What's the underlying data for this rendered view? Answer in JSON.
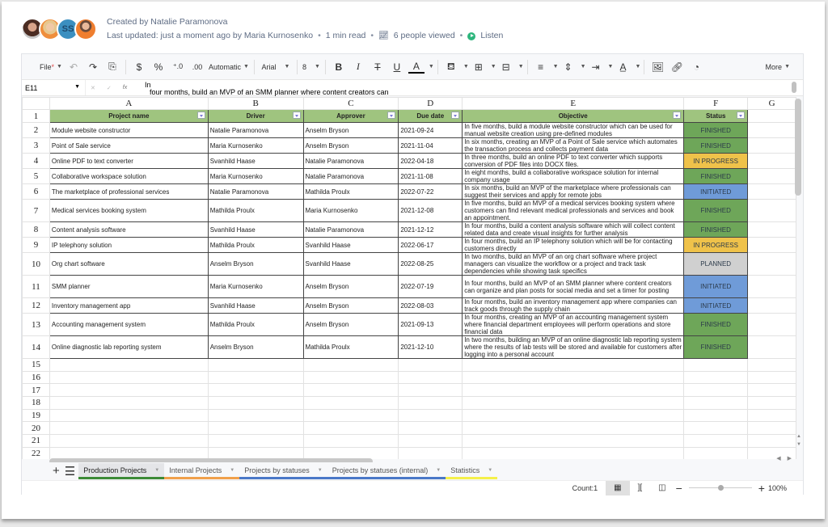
{
  "meta": {
    "created_by": "Created by Natalie Paramonova",
    "last_updated": "Last updated: just a moment ago by Maria Kurnosenko",
    "read_time": "1 min read",
    "viewed": "6 people viewed",
    "listen": "Listen",
    "avatar_initials": "SS"
  },
  "toolbar": {
    "file": "File",
    "file_marker": "*",
    "format": "Automatic",
    "font": "Arial",
    "font_size": "8",
    "more": "More",
    "currency": "$",
    "percent": "%",
    "dec_inc": ".0 .00",
    "dec_dec": ".00 .0"
  },
  "formula_bar": {
    "cell_ref": "E11",
    "value_line1": "In",
    "value_line2": "four months, build an MVP of an SMM planner where content creators can"
  },
  "columns": [
    "A",
    "B",
    "C",
    "D",
    "E",
    "F",
    "G"
  ],
  "headers": [
    "Project   name",
    "Driver",
    "Approver",
    "Due date",
    "Objective",
    "Status"
  ],
  "rows": [
    {
      "num": "2",
      "name": "Module website constructor",
      "driver": "Natalie Paramonova",
      "approver": "Anselm Bryson",
      "due": "2021-09-24",
      "objective": "In   five months, build a module website constructor which can be used for manual   website creation using pre-defined modules",
      "status": "FINISHED"
    },
    {
      "num": "3",
      "name": "Point of Sale service",
      "driver": "Maria Kurnosenko",
      "approver": "Anselm Bryson",
      "due": "2021-11-04",
      "objective": "In   six months, creating an MVP of a Point of Sale service which automates the   transaction process and collects payment data",
      "status": "FINISHED"
    },
    {
      "num": "4",
      "name": "Online PDF to text converter",
      "driver": "Svanhild Haase",
      "approver": "Natalie Paramonova",
      "due": "2022-04-18",
      "objective": "In   three months, build an online PDF to text converter which supports conversion   of PDF files into DOCX files.",
      "status": "IN PROGRESS"
    },
    {
      "num": "5",
      "name": "Collaborative workspace solution",
      "driver": "Maria Kurnosenko",
      "approver": "Natalie Paramonova",
      "due": "2021-11-08",
      "objective": "In   eight months, build a collaborative workspace solution for internal company   usage",
      "status": "FINISHED"
    },
    {
      "num": "6",
      "name": "The marketplace of professional services",
      "driver": "Natalie Paramonova",
      "approver": "Mathilda Proulx",
      "due": "2022-07-22",
      "objective": "In   six months, build an MVP of the marketplace where professionals can  suggest   their services and apply for remote jobs",
      "status": "INITIATED"
    },
    {
      "num": "7",
      "name": "Medical services booking system",
      "driver": "Mathilda Proulx",
      "approver": "Maria Kurnosenko",
      "due": "2021-12-08",
      "objective": "In   five months, build an MVP of a medical services booking system where   customers can find relevant medical professionals and services and book an   appointment.",
      "status": "FINISHED"
    },
    {
      "num": "8",
      "name": "Content analysis software",
      "driver": "Svanhild Haase",
      "approver": "Natalie Paramonova",
      "due": "2021-12-12",
      "objective": "In   four months, build a content analysis software which will collect content   related data and create visual insights for further analysis",
      "status": "FINISHED"
    },
    {
      "num": "9",
      "name": "IP telephony solution",
      "driver": "Mathilda Proulx",
      "approver": "Svanhild Haase",
      "due": "2022-06-17",
      "objective": "In   four months, build an IP telephony solution which will be for contacting   customers directly",
      "status": "IN PROGRESS"
    },
    {
      "num": "10",
      "name": "Org chart software",
      "driver": "Anselm Bryson",
      "approver": "Svanhild Haase",
      "due": "2022-08-25",
      "objective": "In   two months, build an MVP of an org chart software where project managers can   visualize the workflow or a project and track task dependencies while showing   task specifics",
      "status": "PLANNED"
    },
    {
      "num": "11",
      "name": "SMM planner",
      "driver": "Maria Kurnosenko",
      "approver": "Anselm Bryson",
      "due": "2022-07-19",
      "objective": "In   four months, build an MVP of an SMM planner where content creators can   organize and plan posts for social media and set a timer for posting",
      "status": "INITIATED"
    },
    {
      "num": "12",
      "name": "Inventory management app",
      "driver": "Svanhild Haase",
      "approver": "Anselm Bryson",
      "due": "2022-08-03",
      "objective": "In   four months, build an inventory management app where companies can track   goods through the supply chain",
      "status": "INITIATED"
    },
    {
      "num": "13",
      "name": "Accounting management system",
      "driver": "Mathilda Proulx",
      "approver": "Anselm Bryson",
      "due": "2021-09-13",
      "objective": "In   four months, creating an MVP of an accounting management system where   financial department employees will perform operations and store  financial   data",
      "status": "FINISHED"
    },
    {
      "num": "14",
      "name": "Online diagnostic lab reporting system",
      "driver": "Anselm Bryson",
      "approver": "Mathilda Proulx",
      "due": "2021-12-10",
      "objective": "In   two months, building an MVP of an online diagnostic lab reporting system   where the results of lab tests will be stored and available for customers   after logging into a personal account",
      "status": "FINISHED"
    }
  ],
  "empty_rows": [
    "15",
    "16",
    "17",
    "18",
    "19",
    "20",
    "21",
    "22"
  ],
  "header_row_num": "1",
  "status_colors": {
    "FINISHED": "#6ea659",
    "IN PROGRESS": "#efc24a",
    "INITIATED": "#6f9bd8",
    "PLANNED": "#d0d0d0"
  },
  "tabs": [
    {
      "label": "Production Projects",
      "color": "#3d8b37",
      "active": true
    },
    {
      "label": "Internal Projects",
      "color": "#f0a04b",
      "active": false
    },
    {
      "label": "Projects by statuses",
      "color": "#4a78c8",
      "active": false
    },
    {
      "label": "Projects by statuses (internal)",
      "color": "#4a78c8",
      "active": false
    },
    {
      "label": "Statistics",
      "color": "#f5f04a",
      "active": false
    }
  ],
  "statusbar": {
    "count": "Count:1",
    "zoom": "100%",
    "zoom_level_percent": 100
  }
}
